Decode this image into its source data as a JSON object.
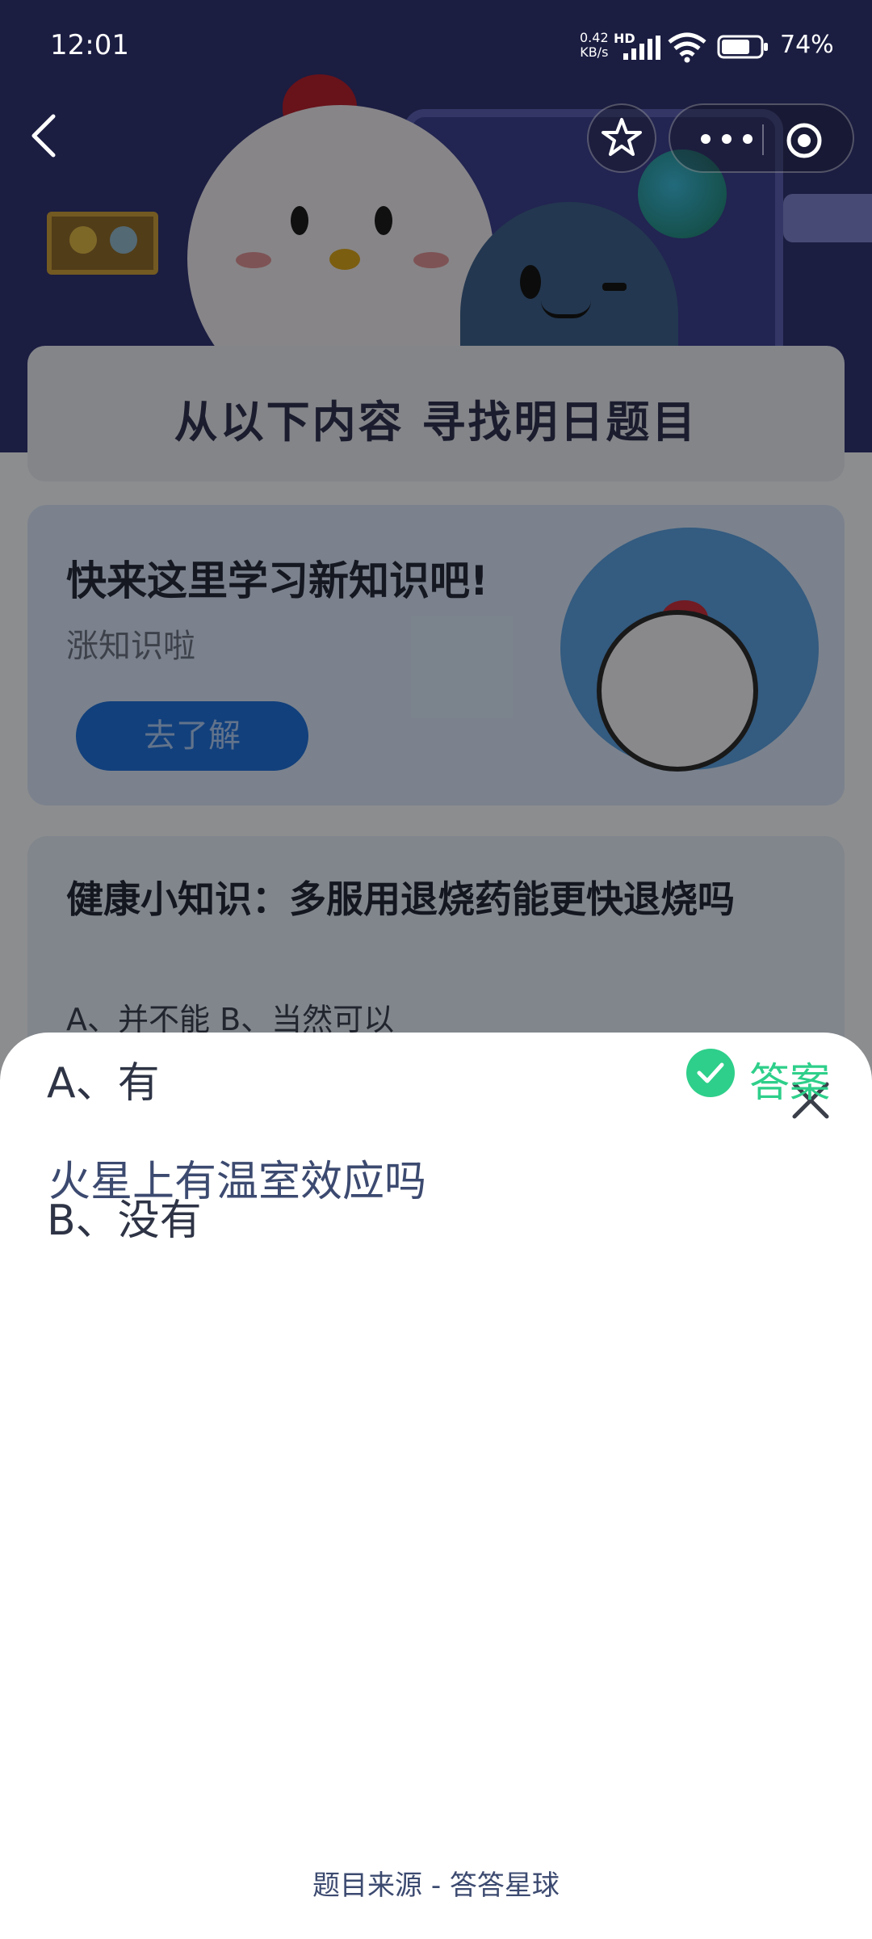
{
  "status_bar": {
    "time": "12:01",
    "net_speed_value": "0.42",
    "net_speed_unit": "KB/s",
    "network_type": "HD",
    "battery_percent": "74%",
    "battery_level": 0.74
  },
  "nav": {
    "back_icon": "chevron-left-icon",
    "favorite_icon": "star-icon",
    "more_icon": "more-dots-icon",
    "close_miniapp_icon": "target-circle-icon"
  },
  "background": {
    "banner_title": "从以下内容  寻找明日题目",
    "promo_card": {
      "heading": "快来这里学习新知识吧!",
      "subheading": "涨知识啦",
      "button_label": "去了解"
    },
    "question_card": {
      "question": "健康小知识：多服用退烧药能更快退烧吗",
      "options": "A、并不能    B、当然可以"
    }
  },
  "sheet": {
    "question": "火星上有温室效应吗",
    "options": [
      {
        "label": "A、有",
        "is_answer": true
      },
      {
        "label": "B、没有",
        "is_answer": false
      }
    ],
    "answer_label": "答案",
    "answer_color": "#2ecf8a",
    "source": "题目来源 - 答答星球"
  }
}
